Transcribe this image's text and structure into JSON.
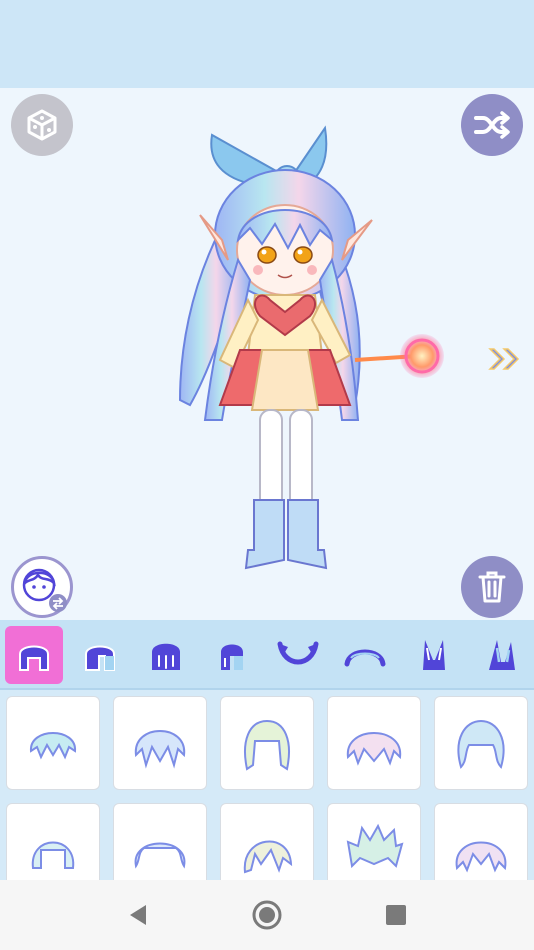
{
  "colors": {
    "top_bar": "#cde6f7",
    "stage_bg": "#eef6fd",
    "tab_strip": "#c4e2f5",
    "active_tab": "#f16fd6",
    "icon_purple": "#5145d8",
    "button_purple": "#8f8ec6",
    "button_gray": "#c4c4cc"
  },
  "toolbar": {
    "random_icon": "dice-icon",
    "shuffle_icon": "shuffle-icon",
    "face_icon": "character-swap-icon",
    "trash_icon": "trash-icon",
    "next_icon": "double-chevron-right-icon"
  },
  "category_tabs": [
    {
      "icon": "hair-front-icon",
      "active": true
    },
    {
      "icon": "hair-split-icon",
      "active": false
    },
    {
      "icon": "hair-back-icon",
      "active": false
    },
    {
      "icon": "hair-side-icon",
      "active": false
    },
    {
      "icon": "horns-icon",
      "active": false
    },
    {
      "icon": "headband-icon",
      "active": false
    },
    {
      "icon": "bunny-ears-icon",
      "active": false
    },
    {
      "icon": "bunny-ears-alt-icon",
      "active": false
    }
  ],
  "hair_items": [
    {
      "style": "short-bob"
    },
    {
      "style": "messy-bob"
    },
    {
      "style": "long-wavy"
    },
    {
      "style": "shaggy"
    },
    {
      "style": "curly-long"
    },
    {
      "style": "straight-bob"
    },
    {
      "style": "curly-short"
    },
    {
      "style": "side-swept"
    },
    {
      "style": "spiky"
    },
    {
      "style": "layered"
    }
  ],
  "nav": {
    "back_icon": "back-triangle-icon",
    "home_icon": "home-circle-icon",
    "recents_icon": "recents-square-icon"
  }
}
